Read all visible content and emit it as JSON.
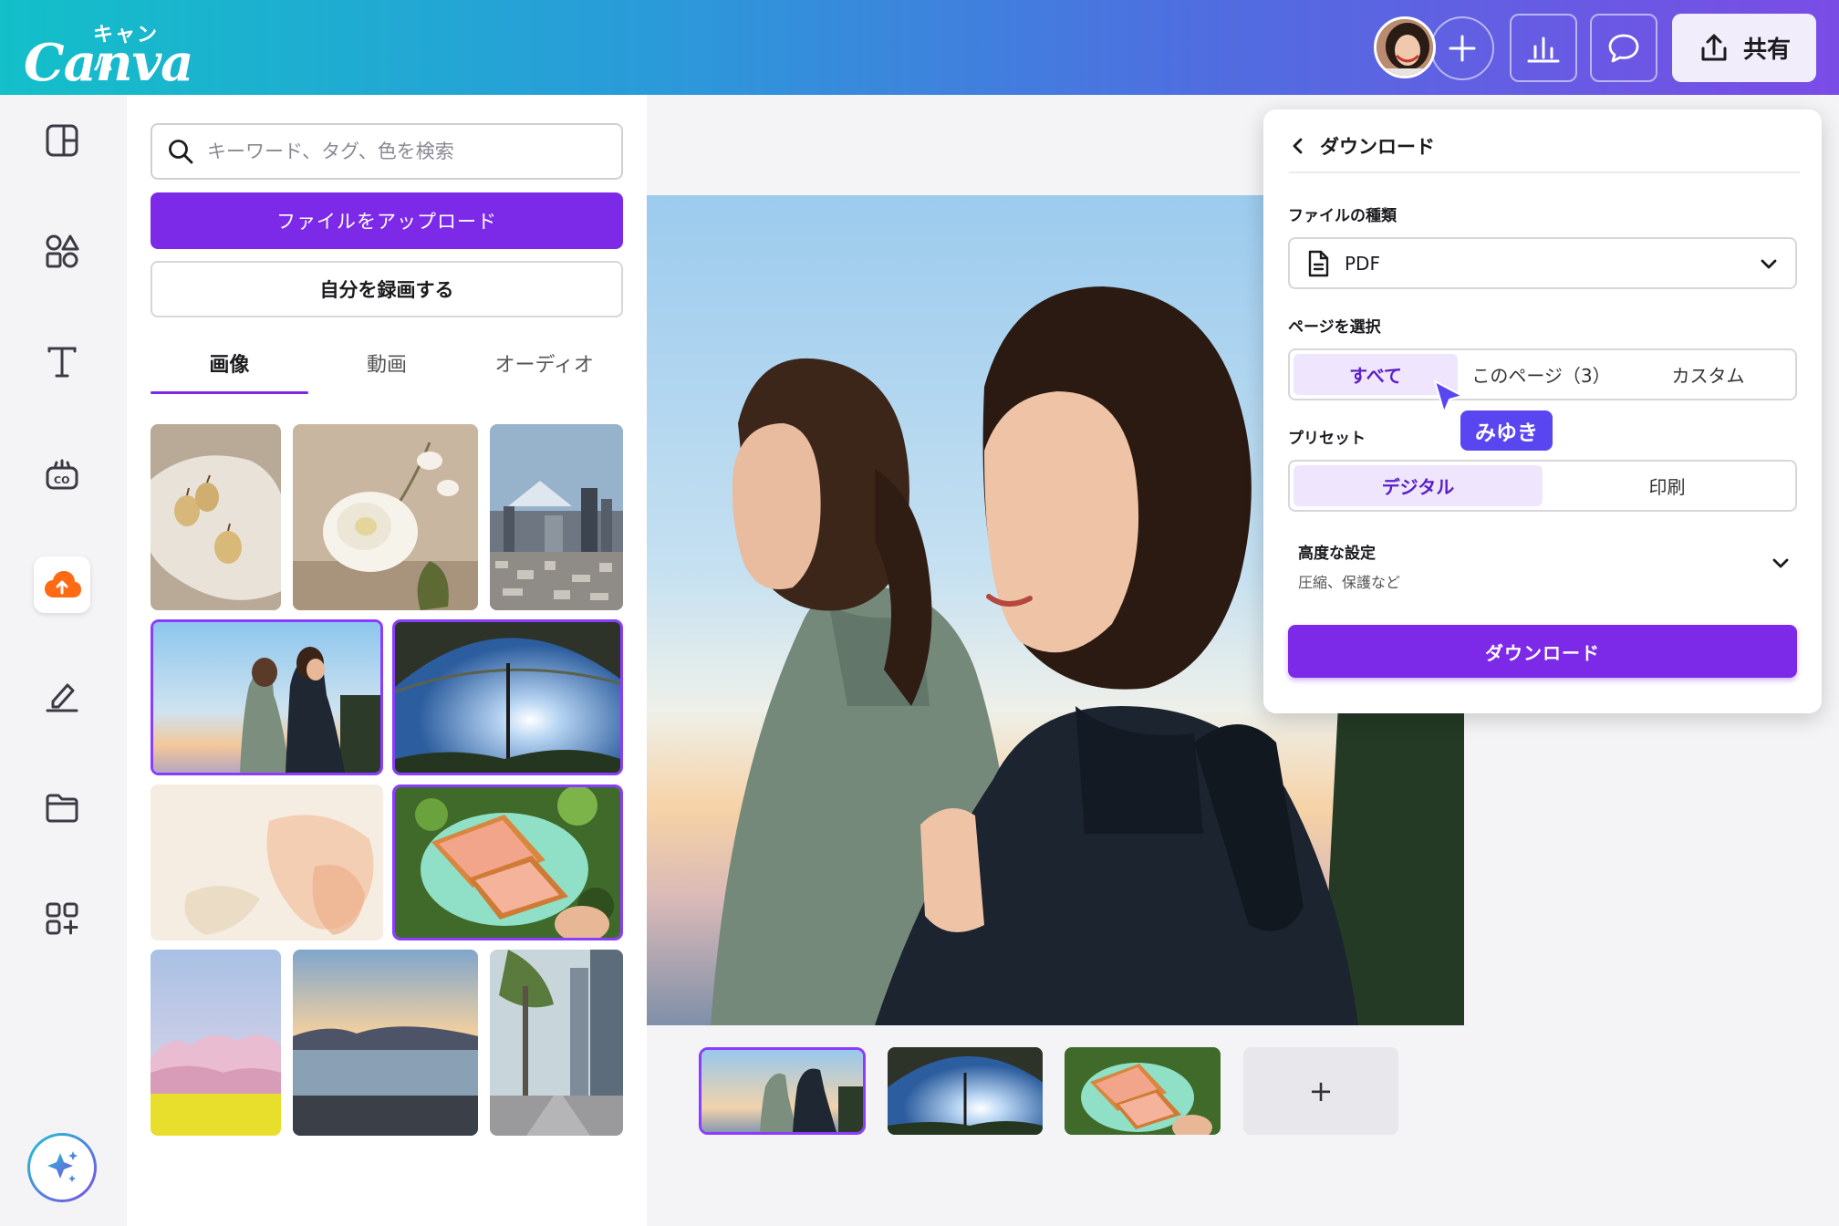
{
  "header": {
    "logo_kana": "キャンバ",
    "logo_text": "Canva",
    "share_label": "共有",
    "colors": {
      "gradient_start": "#13bfc9",
      "gradient_end": "#7a4ce6"
    },
    "icons": [
      "plus-icon",
      "analytics-icon",
      "comment-icon",
      "share-icon"
    ]
  },
  "rail": {
    "icons": [
      "layout-icon",
      "elements-icon",
      "text-icon",
      "brand-icon",
      "uploads-icon",
      "draw-icon",
      "folder-icon",
      "apps-icon",
      "magic-sparkle-icon"
    ],
    "active": "uploads-icon"
  },
  "panel": {
    "search_placeholder": "キーワード、タグ、色を検索",
    "upload_label": "ファイルをアップロード",
    "record_label": "自分を録画する",
    "tabs": [
      {
        "label": "画像",
        "active": true
      },
      {
        "label": "動画",
        "active": false
      },
      {
        "label": "オーディオ",
        "active": false
      }
    ]
  },
  "download": {
    "title": "ダウンロード",
    "file_type_label": "ファイルの種類",
    "file_type_value": "PDF",
    "pages_label": "ページを選択",
    "pages_options": [
      "すべて",
      "このページ（3）",
      "カスタム"
    ],
    "pages_selected": "すべて",
    "preset_label": "プリセット",
    "preset_options": [
      "デジタル",
      "印刷"
    ],
    "preset_selected": "デジタル",
    "advanced_title": "高度な設定",
    "advanced_sub": "圧縮、保護など",
    "button_label": "ダウンロード",
    "accent": "#7d2ae8"
  },
  "collaborator": {
    "name": "みゆき",
    "color": "#5a46f0"
  },
  "pages": {
    "add_label": "+"
  }
}
